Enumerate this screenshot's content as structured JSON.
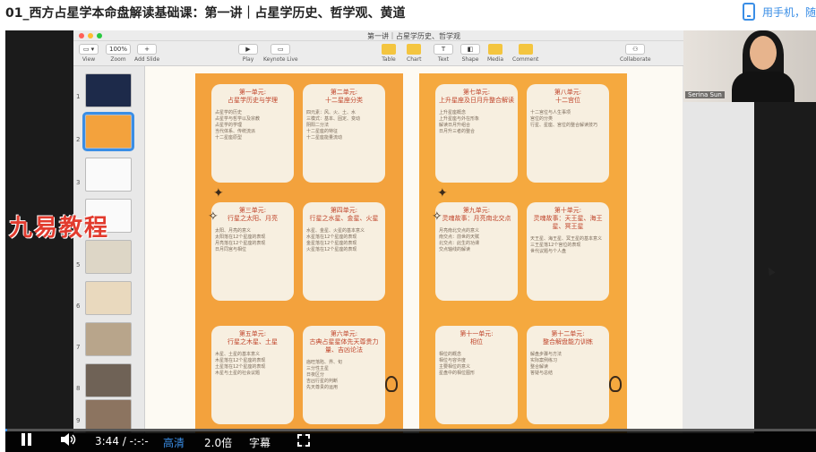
{
  "page": {
    "title": "01_西方占星学本命盘解读基础课：第一讲｜占星学历史、哲学观、黄道",
    "mobile_link": "用手机，随"
  },
  "keynote": {
    "doc_title": "第一讲｜占星学历史、哲学观",
    "toolbar": {
      "view": "View",
      "zoom_value": "100%",
      "zoom": "Zoom",
      "add_slide": "Add Slide",
      "play": "Play",
      "keynote_live": "Keynote Live",
      "table": "Table",
      "chart": "Chart",
      "text": "Text",
      "shape": "Shape",
      "media": "Media",
      "comment": "Comment",
      "collaborate": "Collaborate"
    },
    "thumb_numbers": [
      "1",
      "2",
      "3",
      "4",
      "5",
      "6",
      "7",
      "8",
      "9"
    ],
    "slide_a_cards": [
      {
        "title": "第一单元:\n占星学历史与学理",
        "body": "占星学的历史\n占星学与哲学以及宗教\n占星学的学理\n当代体系、传统流派\n十二星座原型"
      },
      {
        "title": "第二单元:\n十二星座分类",
        "body": "四元素：风、火、土、水\n三模式：基本、固定、变动\n阴阳二分法\n十二星座的特征\n十二星座能量流动"
      },
      {
        "title": "第三单元:\n行星之太阳、月亮",
        "body": "太阳、月亮的意义\n太阳落在12个星座的表现\n月亮落在12个星座的表现\n日月同宫与相位"
      },
      {
        "title": "第四单元:\n行星之水星、金星、火星",
        "body": "水星、金星、火星的基本意义\n水星落在12个星座的表现\n金星落在12个星座的表现\n火星落在12个星座的表现"
      },
      {
        "title": "第五单元:\n行星之木星、土星",
        "body": "木星、土星的基本意义\n木星落在12个星座的表现\n土星落在12个星座的表现\n木星与土星的社会议题"
      },
      {
        "title": "第六单元:\n古典占星星体先天尊贵力量、吉凶论法",
        "body": "庙旺落陷、界、旬\n三分性主星\n日夜区分\n吉凶行星的判断\n先天尊贵的运用"
      }
    ],
    "slide_b_cards": [
      {
        "title": "第七单元:\n上升星座及日月升整合解读",
        "body": "上升星座概念\n上升星座与外在形象\n解读日月升组合\n日月升三者的整合"
      },
      {
        "title": "第八单元:\n十二宫位",
        "body": "十二宫位与人生事项\n宫位的分类\n行星、星座、宫位的整合解读技巧"
      },
      {
        "title": "第九单元:\n灵魂故事：月亮南北交点",
        "body": "月亮南北交点的意义\n南交点：前世的天赋\n北交点：此生的功课\n交点轴线的解读"
      },
      {
        "title": "第十单元:\n灵魂故事：天王星、海王星、冥王星",
        "body": "天王星、海王星、冥王星的基本意义\n三王星落12个宫位的表现\n世代议题与个人盘"
      },
      {
        "title": "第十一单元:\n相位",
        "body": "相位的概念\n相位与容许度\n主要相位的意义\n星盘中的相位图形"
      },
      {
        "title": "第十二单元:\n整合解盘能力训练",
        "body": "解盘步骤与方法\n实际案例练习\n整合解读\n答疑与总结"
      }
    ]
  },
  "webcam": {
    "name": "Serina Sun"
  },
  "watermark": "九易教程",
  "player": {
    "time": "3:44 / -:-:-",
    "quality": "高清",
    "speed": "2.0倍",
    "subtitles": "字幕",
    "progress": 0.002
  }
}
